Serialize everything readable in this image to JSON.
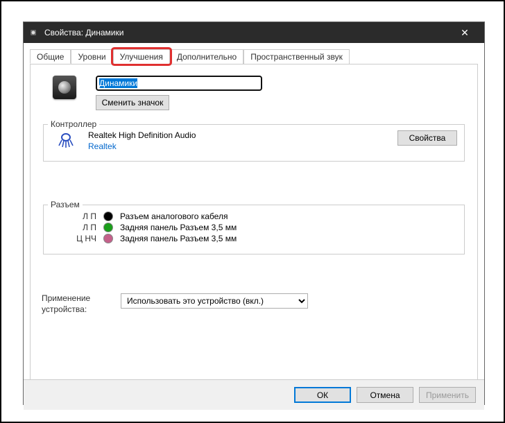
{
  "window": {
    "title": "Свойства: Динамики",
    "close_label": "✕"
  },
  "tabs": {
    "general": "Общие",
    "levels": "Уровни",
    "enhancements": "Улучшения",
    "advanced": "Дополнительно",
    "spatial": "Пространственный звук"
  },
  "device": {
    "name": "Динамики",
    "change_icon_label": "Сменить значок"
  },
  "controller": {
    "legend": "Контроллер",
    "name": "Realtek High Definition Audio",
    "vendor": "Realtek",
    "properties_label": "Свойства"
  },
  "jack": {
    "legend": "Разъем",
    "rows": [
      {
        "label": "Л П",
        "color": "#000000",
        "desc": "Разъем аналогового кабеля"
      },
      {
        "label": "Л П",
        "color": "#1b9e1b",
        "desc": "Задняя панель Разъем 3,5 мм"
      },
      {
        "label": "Ц НЧ",
        "color": "#c4608a",
        "desc": "Задняя панель Разъем 3,5 мм"
      }
    ]
  },
  "usage": {
    "label": "Применение устройства:",
    "selected": "Использовать это устройство (вкл.)"
  },
  "buttons": {
    "ok": "ОК",
    "cancel": "Отмена",
    "apply": "Применить"
  }
}
